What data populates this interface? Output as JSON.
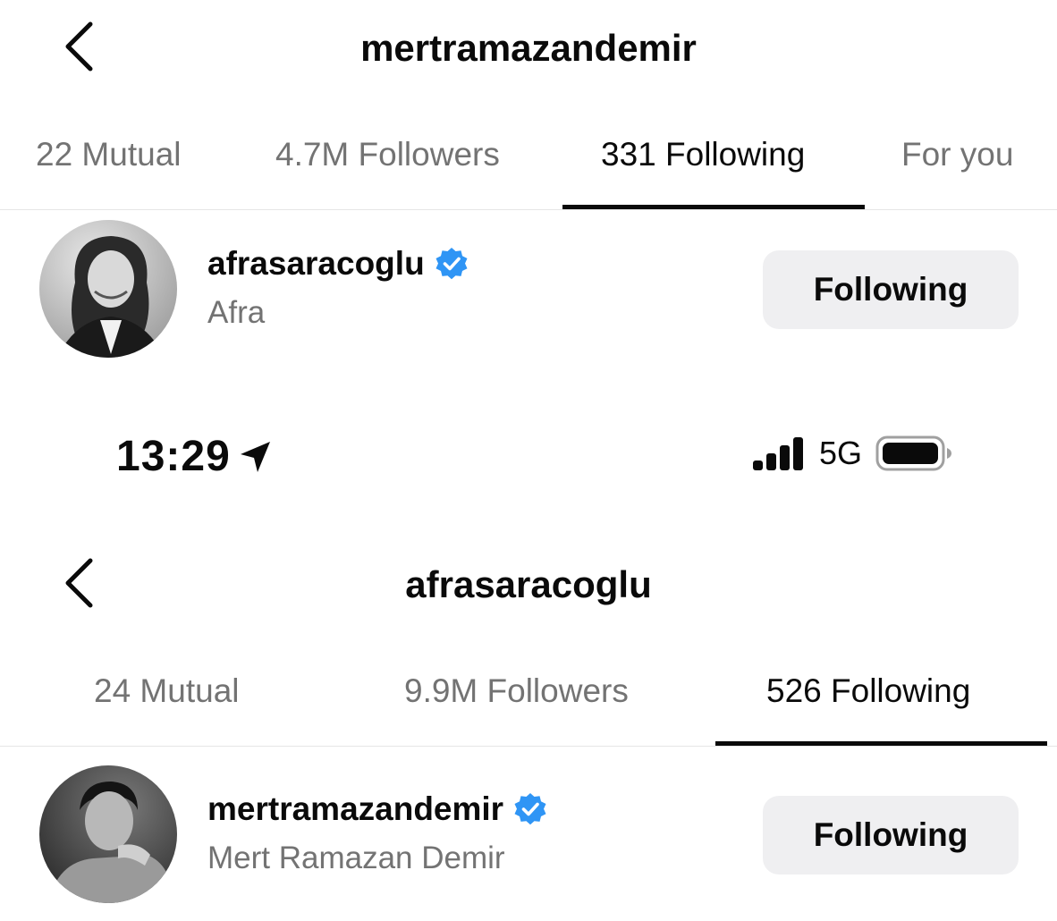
{
  "top": {
    "title": "mertramazandemir",
    "tabs": [
      {
        "label": "22 Mutual"
      },
      {
        "label": "4.7M Followers"
      },
      {
        "label": "331 Following",
        "active": true
      },
      {
        "label": "For you"
      }
    ],
    "user": {
      "username": "afrasaracoglu",
      "full_name": "Afra",
      "verified": true,
      "button": "Following"
    }
  },
  "status_bar": {
    "time": "13:29",
    "network": "5G",
    "icons": [
      "location-arrow-icon",
      "signal-bars-icon",
      "battery-icon"
    ]
  },
  "bottom": {
    "title": "afrasaracoglu",
    "tabs": [
      {
        "label": "24 Mutual"
      },
      {
        "label": "9.9M Followers"
      },
      {
        "label": "526 Following",
        "active": true
      }
    ],
    "user": {
      "username": "mertramazandemir",
      "full_name": "Mert Ramazan Demir",
      "verified": true,
      "button": "Following"
    }
  },
  "colors": {
    "text": "#0a0a0a",
    "secondary": "#737373",
    "verified_blue": "#2f95f5",
    "button_bg": "#efeff1"
  }
}
